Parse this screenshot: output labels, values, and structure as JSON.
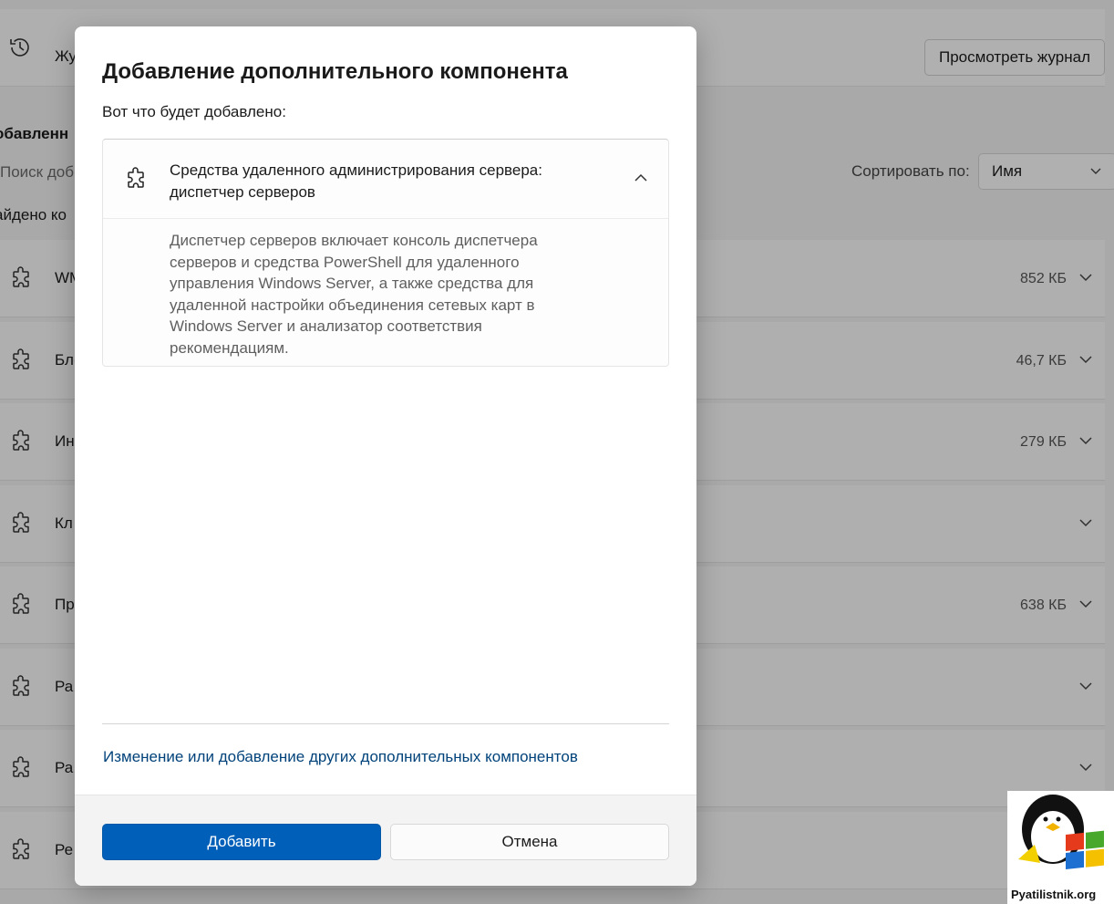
{
  "background": {
    "history_label": "Жу",
    "view_log_button": "Просмотреть журнал",
    "section_title": "обавленн",
    "search_placeholder": "Поиск доб",
    "found_label": "айдено ко",
    "sort_label": "Сортировать по:",
    "sort_value": "Имя",
    "rows": [
      {
        "label": "WM",
        "size": "852 КБ"
      },
      {
        "label": "Бло",
        "size": "46,7 КБ"
      },
      {
        "label": "Ин",
        "size": "279 КБ"
      },
      {
        "label": "Кл",
        "size": ""
      },
      {
        "label": "Пр",
        "size": "638 КБ"
      },
      {
        "label": "Ра",
        "size": ""
      },
      {
        "label": "Ра",
        "size": ""
      },
      {
        "label": "Ре",
        "size": ""
      }
    ]
  },
  "dialog": {
    "title": "Добавление дополнительного компонента",
    "subtitle": "Вот что будет добавлено:",
    "feature": {
      "name": "Средства удаленного администрирования сервера: диспетчер серверов",
      "description": "Диспетчер серверов включает консоль диспетчера серверов и средства PowerShell для удаленного управления Windows Server, а также средства для удаленной настройки объединения сетевых карт в Windows Server и анализатор соответствия рекомендациям."
    },
    "link": "Изменение или добавление других дополнительных компонентов",
    "add_button": "Добавить",
    "cancel_button": "Отмена"
  },
  "watermark": {
    "text": "Pyatilistnik.org"
  },
  "colors": {
    "accent": "#005fb8",
    "link": "#00427a"
  }
}
